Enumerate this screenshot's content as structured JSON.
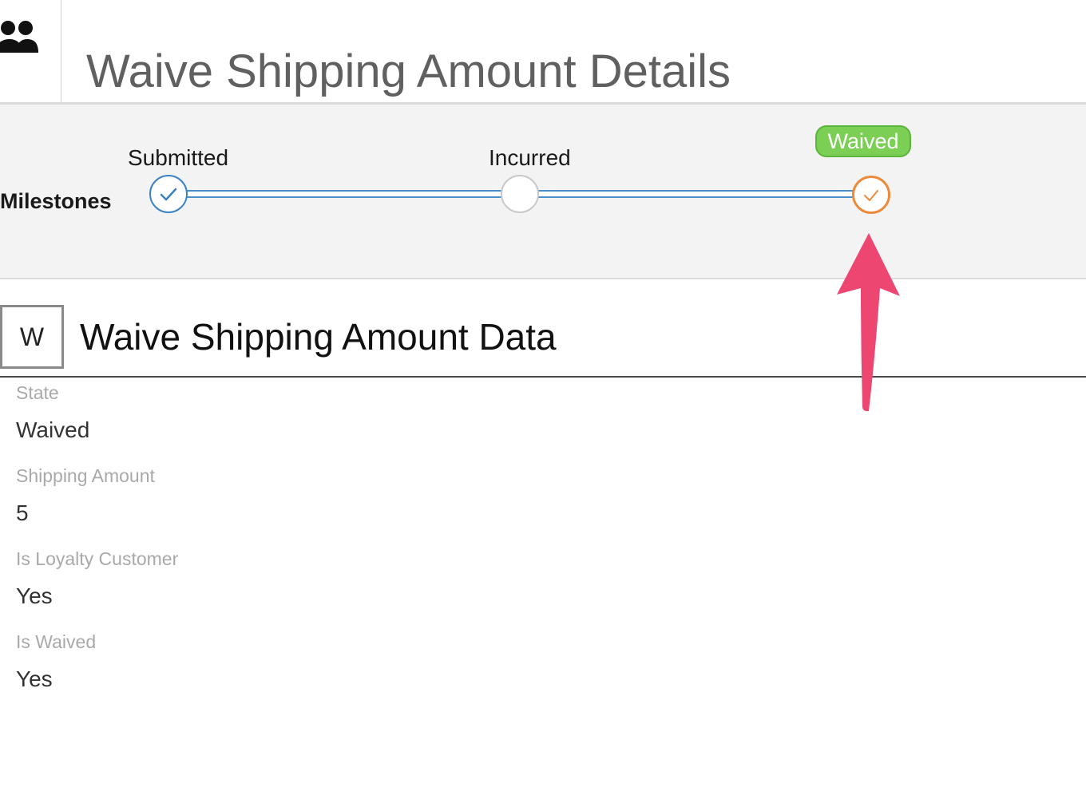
{
  "header": {
    "icon": "people-icon",
    "title": "Waive Shipping Amount Details"
  },
  "milestones": {
    "label": "Milestones",
    "steps": [
      {
        "label": "Submitted",
        "status": "completed",
        "color": "#3b82c4"
      },
      {
        "label": "Incurred",
        "status": "pending",
        "color": "#c8c8c8"
      },
      {
        "label": "",
        "status": "current",
        "color": "#ec8a3a",
        "badge": "Waived",
        "badge_color": "#7ccf55"
      }
    ]
  },
  "data_section": {
    "avatar_letter": "W",
    "title": "Waive Shipping Amount Data",
    "fields": [
      {
        "label": "State",
        "value": "Waived"
      },
      {
        "label": "Shipping Amount",
        "value": "5"
      },
      {
        "label": "Is Loyalty Customer",
        "value": "Yes"
      },
      {
        "label": "Is Waived",
        "value": "Yes"
      }
    ]
  },
  "annotation": {
    "icon": "arrow-up-icon",
    "color": "#ec4671"
  }
}
